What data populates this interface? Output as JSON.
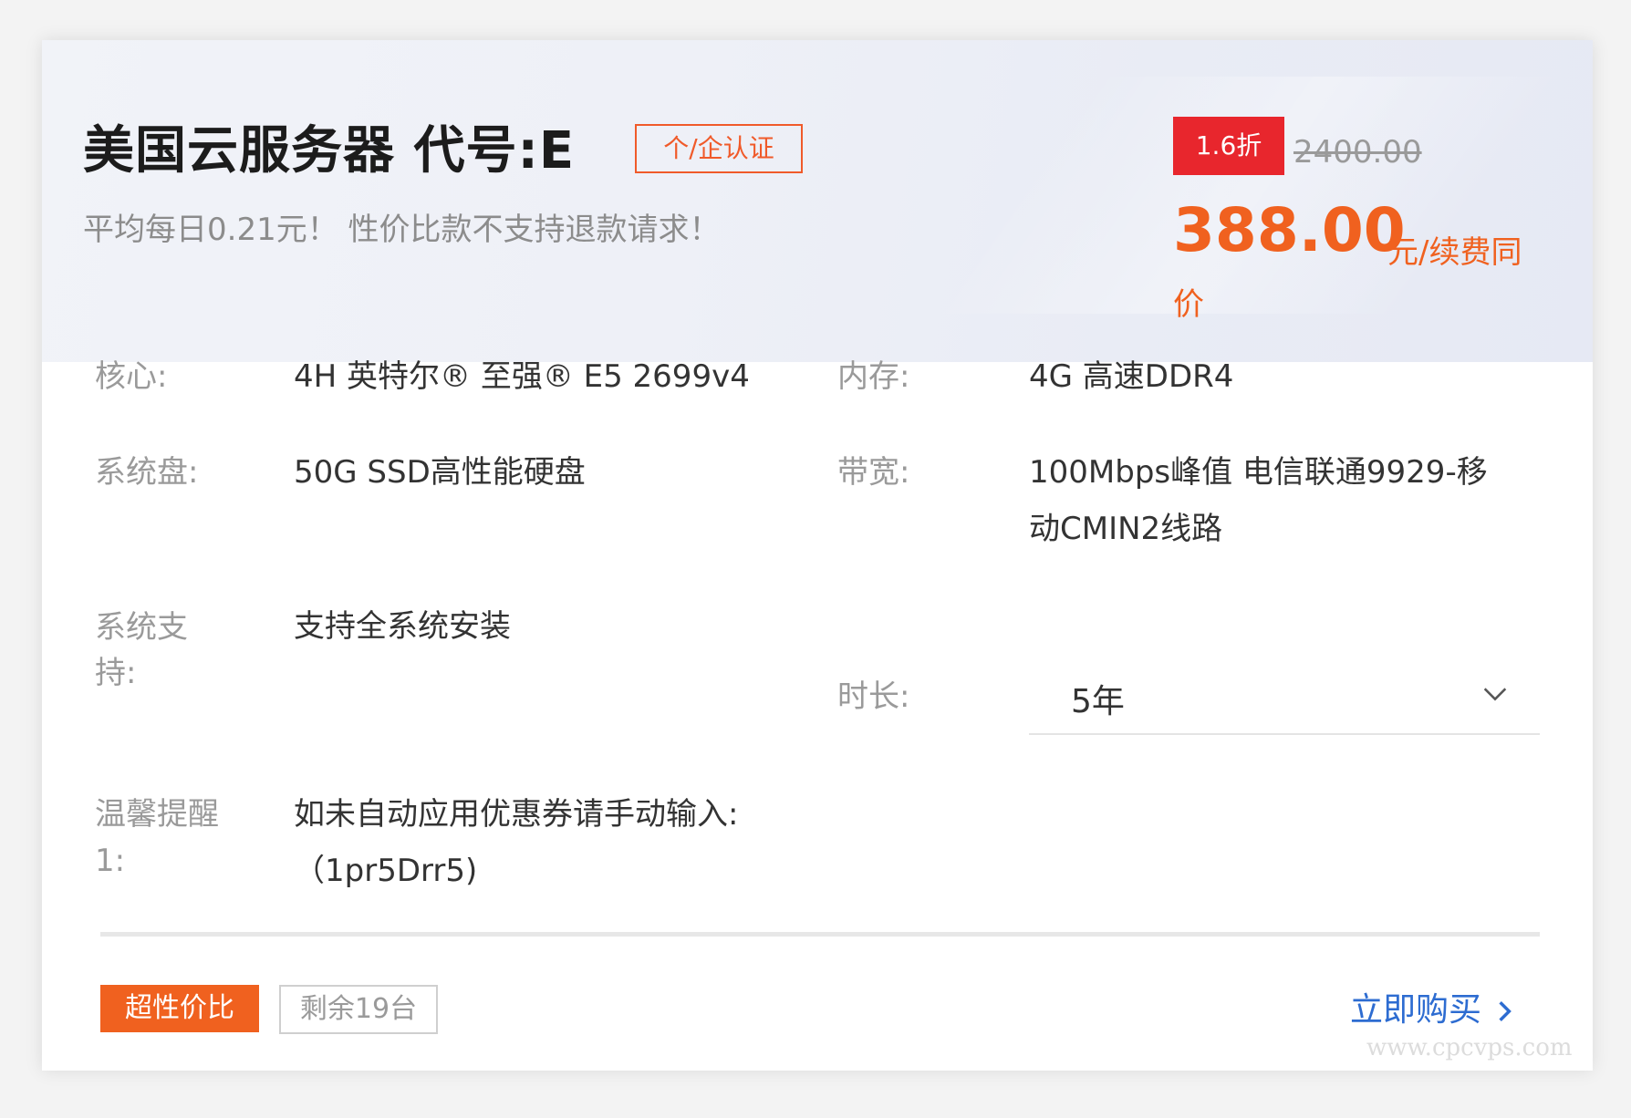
{
  "header": {
    "title": "美国云服务器 代号:E",
    "cert_tag": "个/企认证",
    "subtitle": "平均每日0.21元！ 性价比款不支持退款请求！"
  },
  "pricing": {
    "discount": "1.6折",
    "original_price": "2400.00",
    "price": "388.00",
    "unit_line1": "元/续费同",
    "unit_line2": "价"
  },
  "specs": {
    "cpu_label": "核心:",
    "cpu_value": "4H 英特尔® 至强® E5 2699v4",
    "memory_label": "内存:",
    "memory_value": "4G 高速DDR4",
    "disk_label": "系统盘:",
    "disk_value": "50G SSD高性能硬盘",
    "bandwidth_label": "带宽:",
    "bandwidth_value_line1": "100Mbps峰值 电信联通9929-移",
    "bandwidth_value_line2": "动CMIN2线路",
    "os_label_line1": "系统支",
    "os_label_line2": "持:",
    "os_value": "支持全系统安装",
    "duration_label": "时长:",
    "duration_selected": "5年",
    "tip_label_line1": "温馨提醒",
    "tip_label_line2": "1:",
    "tip_value_line1": "如未自动应用优惠券请手动输入:",
    "tip_value_line2": "（1pr5Drr5)"
  },
  "footer": {
    "badge_value": "超性价比",
    "badge_stock": "剩余19台",
    "buy_label": "立即购买",
    "watermark": "www.cpcvps.com"
  },
  "colors": {
    "accent_orange": "#f0611f",
    "discount_red": "#e8262d",
    "link_blue": "#2d6cd1"
  },
  "icons": {
    "select_chevron": "chevron-down-icon",
    "buy_arrow": "chevron-right-icon"
  }
}
